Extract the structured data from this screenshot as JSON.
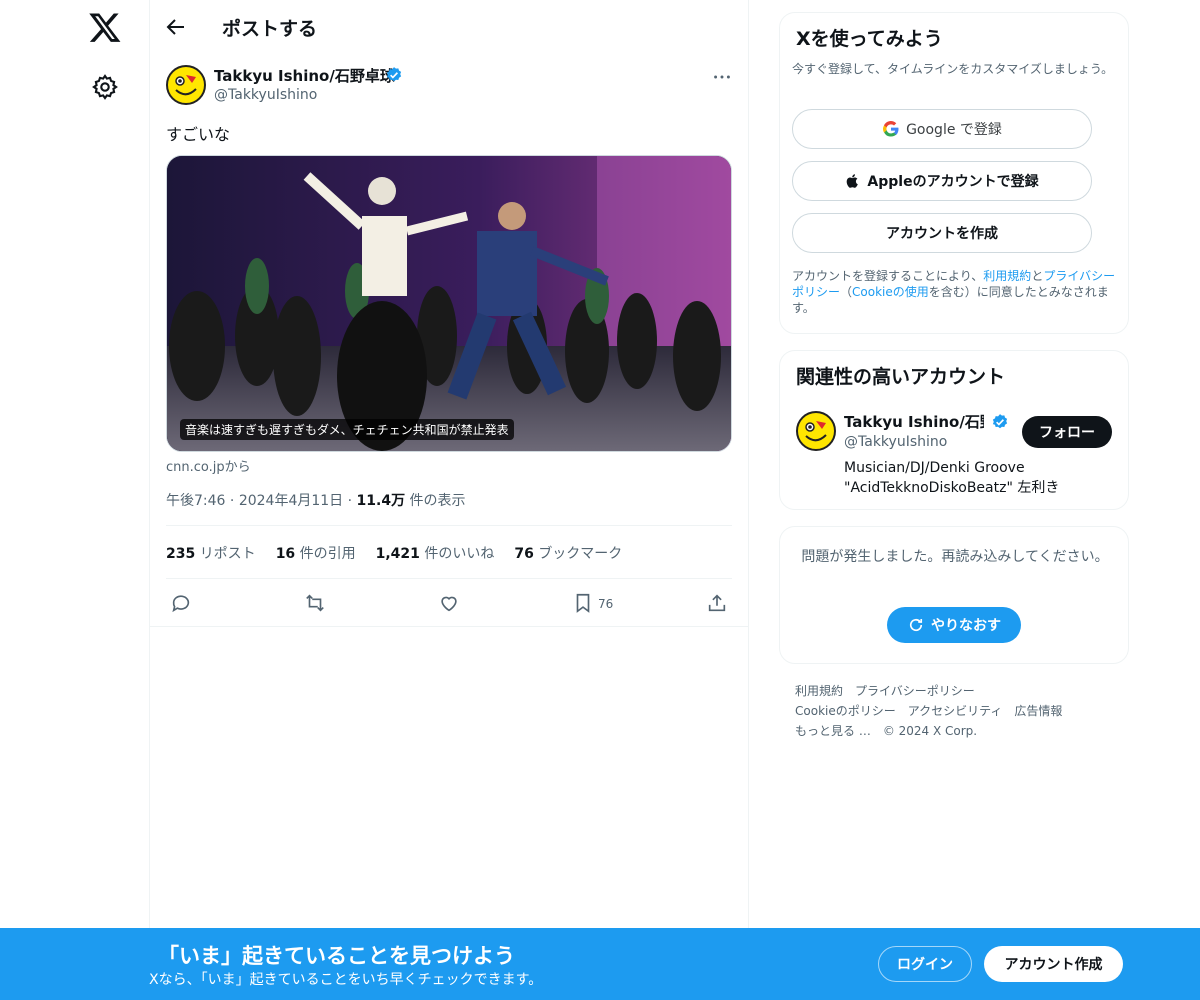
{
  "header": {
    "title": "ポストする"
  },
  "post": {
    "author_name": "Takkyu Ishino/石野卓球",
    "author_handle": "@TakkyuIshino",
    "text": "すごいな",
    "card_caption": "音楽は速すぎも遅すぎもダメ、チェチェン共和国が禁止発表",
    "card_source": "cnn.co.jpから",
    "time": "午後7:46",
    "date": "2024年4月11日",
    "views_count": "11.4万",
    "views_label": "件の表示",
    "stats": {
      "reposts_count": "235",
      "reposts_label": "リポスト",
      "quotes_count": "16",
      "quotes_label": "件の引用",
      "likes_count": "1,421",
      "likes_label": "件のいいね",
      "bookmarks_count": "76",
      "bookmarks_label": "ブックマーク"
    },
    "bookmark_action_count": "76"
  },
  "signup": {
    "title": "Xを使ってみよう",
    "subtitle": "今すぐ登録して、タイムラインをカスタマイズしましょう。",
    "google_label": "Google で登録",
    "apple_label": "Appleのアカウントで登録",
    "create_label": "アカウントを作成",
    "terms_1": "アカウントを登録することにより、",
    "terms_link1": "利用規約",
    "terms_2": "と",
    "terms_link2": "プライバシーポリシー",
    "terms_3": "（",
    "terms_link3": "Cookieの使用",
    "terms_4": "を含む）に同意したとみなされます。"
  },
  "related": {
    "title": "関連性の高いアカウント",
    "name": "Takkyu Ishino/石野卓球",
    "handle": "@TakkyuIshino",
    "follow_label": "フォロー",
    "bio": "Musician/DJ/Denki Groove \"AcidTekknoDiskoBeatz\" 左利き"
  },
  "error": {
    "message": "問題が発生しました。再読み込みしてください。",
    "retry_label": "やりなおす"
  },
  "footer": {
    "links": [
      "利用規約",
      "プライバシーポリシー",
      "Cookieのポリシー",
      "アクセシビリティ",
      "広告情報",
      "もっと見る …"
    ],
    "copyright": "© 2024 X Corp."
  },
  "bottom_bar": {
    "title": "「いま」起きていることを見つけよう",
    "subtitle": "Xなら、「いま」起きていることをいち早くチェックできます。",
    "login_label": "ログイン",
    "signup_label": "アカウント作成"
  },
  "colors": {
    "accent": "#1d9bf0",
    "text": "#0f1419",
    "muted": "#536471"
  }
}
